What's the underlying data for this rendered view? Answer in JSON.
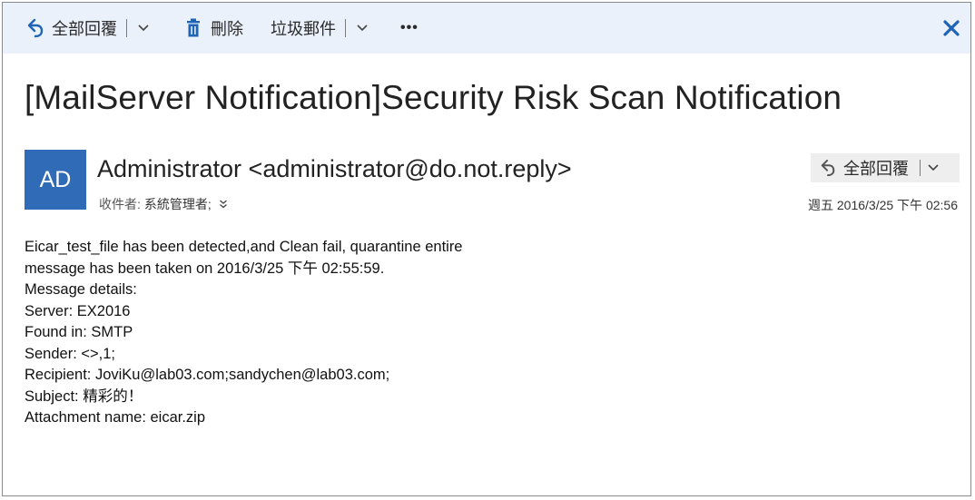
{
  "toolbar": {
    "reply_all_label": "全部回覆",
    "delete_label": "刪除",
    "junk_label": "垃圾郵件",
    "more_label": "•••"
  },
  "message": {
    "subject": "[MailServer Notification]Security Risk Scan Notification",
    "avatar_initials": "AD",
    "sender": "Administrator <administrator@do.not.reply>",
    "to_label": "收件者:",
    "to_value": "系統管理者;",
    "reply_all_label": "全部回覆",
    "date": "週五 2016/3/25 下午 02:56",
    "body_lines": [
      "Eicar_test_file has been detected,and Clean fail, quarantine entire",
      "message has been taken on 2016/3/25 下午 02:55:59.",
      "Message details:",
      "Server: EX2016",
      "Found in: SMTP",
      "Sender: <>,1;",
      "Recipient: JoviKu@lab03.com;sandychen@lab03.com;",
      "Subject: 精彩的！",
      "Attachment name: eicar.zip"
    ]
  },
  "icons": {
    "reply_all": "reply-all-icon",
    "delete": "trash-icon",
    "close": "close-icon",
    "chevron": "chevron-down-icon",
    "expand": "double-chevron-down-icon"
  },
  "colors": {
    "toolbar_bg": "#eaf1fa",
    "accent": "#1f63b5",
    "avatar_bg": "#2f6bb6"
  }
}
